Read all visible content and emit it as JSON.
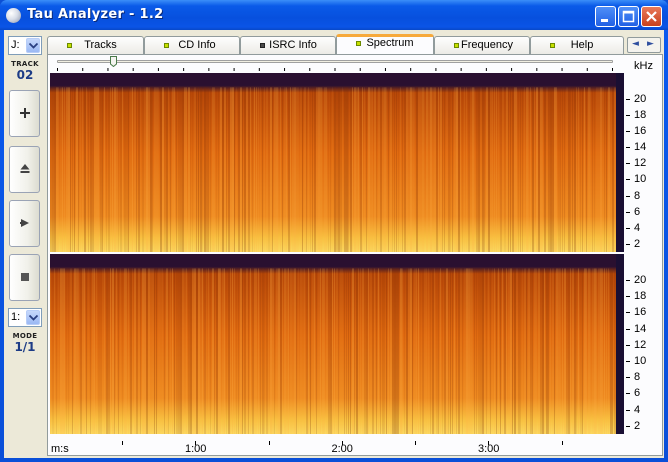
{
  "window": {
    "title": "Tau Analyzer - 1.2",
    "minimize_glyph": "_",
    "maximize_glyph": "□",
    "close_glyph": "✕"
  },
  "left_panel": {
    "drive_value": "J:",
    "track_label": "TRACK",
    "track_value": "02",
    "buttons": [
      {
        "name": "add-button",
        "glyph": "+",
        "icon": "plus-icon"
      },
      {
        "name": "eject-button",
        "glyph": "⏏",
        "icon": "eject-icon"
      },
      {
        "name": "play-button",
        "glyph": "▶",
        "icon": "play-icon"
      },
      {
        "name": "stop-button",
        "glyph": "■",
        "icon": "stop-icon"
      }
    ],
    "mode_select_value": "1:",
    "mode_label": "MODE",
    "mode_value": "1/1"
  },
  "tabs": [
    {
      "label": "Tracks",
      "led": "green"
    },
    {
      "label": "CD Info",
      "led": "green"
    },
    {
      "label": "ISRC Info",
      "led": "dark"
    },
    {
      "label": "Spectrum",
      "led": "green",
      "active": true
    },
    {
      "label": "Frequency",
      "led": "green"
    },
    {
      "label": "Help",
      "led": "green"
    }
  ],
  "tab_scroll": {
    "left": "◄",
    "right": "►"
  },
  "spectrum": {
    "unit_label": "kHz",
    "frequency_ticks": [
      "20",
      "18",
      "16",
      "14",
      "12",
      "10",
      "8",
      "6",
      "4",
      "2"
    ],
    "time_axis_label": "m:s",
    "time_ticks": [
      "1:00",
      "2:00",
      "3:00"
    ],
    "slider_position": 0.1,
    "channels": 2,
    "colors": {
      "low": "#f8c040",
      "mid": "#e06a10",
      "high": "#b84808",
      "top": "#2a1030",
      "cursor": "#1a0f33"
    }
  }
}
